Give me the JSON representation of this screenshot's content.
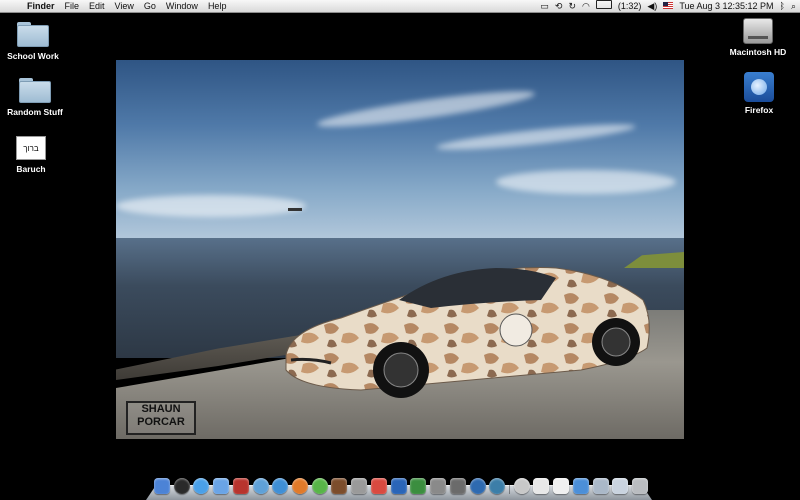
{
  "menubar": {
    "apple": "",
    "app_name": "Finder",
    "menus": [
      "File",
      "Edit",
      "View",
      "Go",
      "Window",
      "Help"
    ],
    "battery_time": "(1:32)",
    "clock": "Tue Aug 3  12:35:12 PM"
  },
  "desktop_icons_left": [
    {
      "label": "School Work",
      "icon": "folder-icon"
    },
    {
      "label": "Random Stuff",
      "icon": "folder-icon"
    },
    {
      "label": "Baruch",
      "icon": "document-icon",
      "doc_text": "ברוך"
    }
  ],
  "desktop_icons_right": [
    {
      "label": "Macintosh HD",
      "icon": "hard-drive-icon"
    },
    {
      "label": "Firefox",
      "icon": "firefox-icon"
    }
  ],
  "wallpaper": {
    "watermark": "SHAUN\nPORCAR"
  },
  "dock": {
    "apps": [
      {
        "name": "finder-icon",
        "color": "#4c83d6"
      },
      {
        "name": "dashboard-icon",
        "color": "#2a2a2a"
      },
      {
        "name": "ichat-icon",
        "color": "#4aa0e8"
      },
      {
        "name": "mail-icon",
        "color": "#6aa4e6"
      },
      {
        "name": "dictionary-icon",
        "color": "#b8342d"
      },
      {
        "name": "safari-icon",
        "color": "#5fa1d8"
      },
      {
        "name": "itunes-icon",
        "color": "#3f8fd6"
      },
      {
        "name": "firefox-icon",
        "color": "#e07a2a"
      },
      {
        "name": "facetime-icon",
        "color": "#58b548"
      },
      {
        "name": "iphoto-icon",
        "color": "#7c4d2c"
      },
      {
        "name": "preview-icon",
        "color": "#9a9a9a"
      },
      {
        "name": "ical-icon",
        "color": "#d94a40"
      },
      {
        "name": "word-icon",
        "color": "#2a65b8"
      },
      {
        "name": "excel-icon",
        "color": "#3b8e3f"
      },
      {
        "name": "script-icon",
        "color": "#8a8a8a"
      },
      {
        "name": "photo-booth-icon",
        "color": "#6b6b6b"
      },
      {
        "name": "earth-icon",
        "color": "#2e6ab0"
      },
      {
        "name": "app-icon",
        "color": "#3c7ea8"
      },
      {
        "name": "separator",
        "color": ""
      },
      {
        "name": "disk-icon",
        "color": "#c8c8c8"
      },
      {
        "name": "document-icon",
        "color": "#e8e8e8"
      },
      {
        "name": "text-file-icon",
        "color": "#f0f0f0"
      },
      {
        "name": "appstore-icon",
        "color": "#4c8fd8"
      },
      {
        "name": "folder-icon",
        "color": "#aab8c8"
      },
      {
        "name": "downloads-icon",
        "color": "#c9d3df"
      },
      {
        "name": "trash-icon",
        "color": "#b9bcc0"
      }
    ]
  }
}
